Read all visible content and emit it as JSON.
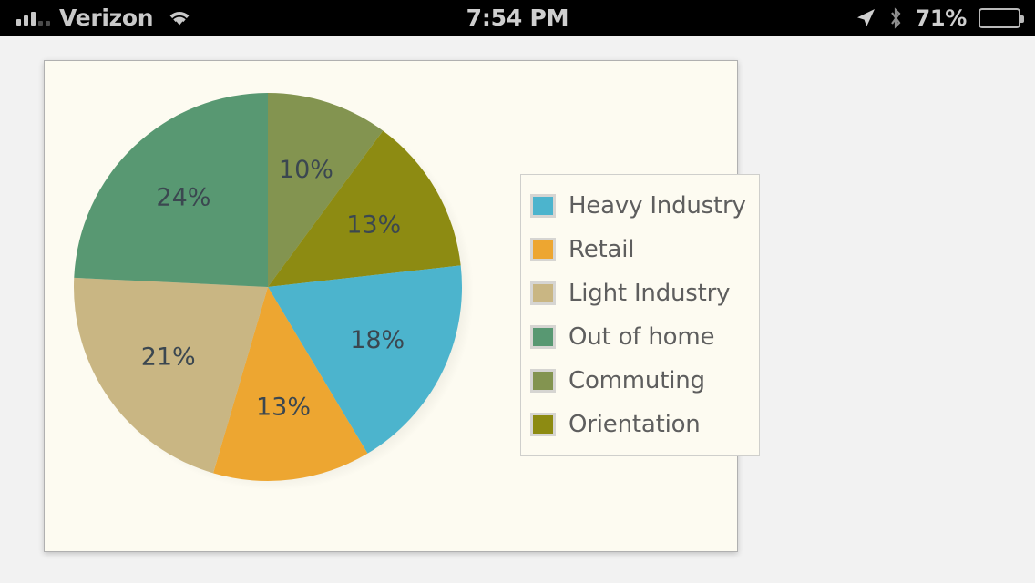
{
  "statusbar": {
    "carrier": "Verizon",
    "time": "7:54 PM",
    "battery_percent": "71%",
    "wifi_icon": "wifi-icon",
    "location_icon": "location-arrow-icon",
    "bluetooth_icon": "bluetooth-icon",
    "battery_icon": "battery-icon",
    "signal_icon": "signal-bars-icon"
  },
  "colors": {
    "page_background": "#f2f2f2",
    "panel_background": "#fdfbf1",
    "panel_border": "#b0b0b0",
    "legend_border": "#cfcfcc",
    "swatch_border": "#d6d5d2",
    "label_text": "#3b4750",
    "legend_text": "#5e5e5e"
  },
  "chart_data": {
    "type": "pie",
    "title": "",
    "legend_position": "right",
    "start_angle_deg": 0,
    "direction": "clockwise",
    "categories": [
      "Heavy Industry",
      "Retail",
      "Light Industry",
      "Out of home",
      "Commuting",
      "Orientation"
    ],
    "values": [
      18,
      13,
      21,
      24,
      10,
      13
    ],
    "labels": [
      "18%",
      "13%",
      "21%",
      "24%",
      "10%",
      "13%"
    ],
    "colors": [
      "#4cb4cd",
      "#eda631",
      "#c9b683",
      "#589872",
      "#839450",
      "#8d8b12"
    ],
    "draw_order": [
      "Commuting",
      "Orientation",
      "Heavy Industry",
      "Retail",
      "Light Industry",
      "Out of home"
    ],
    "slices": [
      {
        "name": "Commuting",
        "value": 10,
        "label": "10%",
        "color": "#839450"
      },
      {
        "name": "Orientation",
        "value": 13,
        "label": "13%",
        "color": "#8d8b12"
      },
      {
        "name": "Heavy Industry",
        "value": 18,
        "label": "18%",
        "color": "#4cb4cd"
      },
      {
        "name": "Retail",
        "value": 13,
        "label": "13%",
        "color": "#eda631"
      },
      {
        "name": "Light Industry",
        "value": 21,
        "label": "21%",
        "color": "#c9b683"
      },
      {
        "name": "Out of home",
        "value": 24,
        "label": "24%",
        "color": "#589872"
      }
    ]
  },
  "legend": {
    "items": [
      {
        "label": "Heavy Industry",
        "color": "#4cb4cd"
      },
      {
        "label": "Retail",
        "color": "#eda631"
      },
      {
        "label": "Light Industry",
        "color": "#c9b683"
      },
      {
        "label": "Out of home",
        "color": "#589872"
      },
      {
        "label": "Commuting",
        "color": "#839450"
      },
      {
        "label": "Orientation",
        "color": "#8d8b12"
      }
    ]
  }
}
